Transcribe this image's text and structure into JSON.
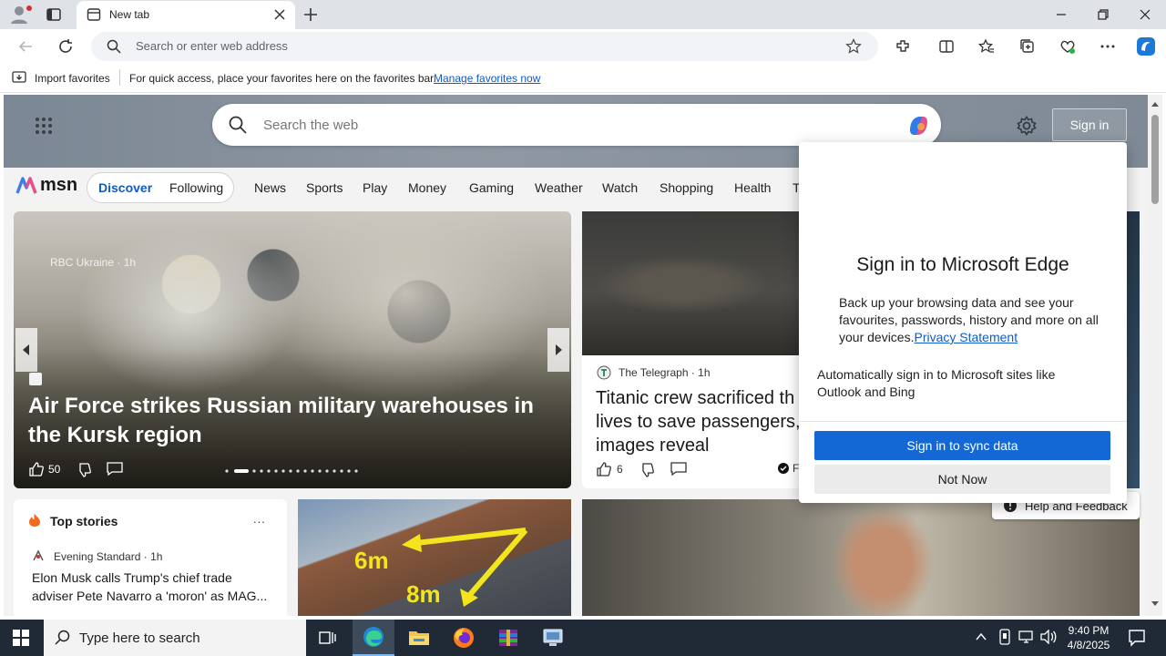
{
  "browser": {
    "tab_title": "New tab",
    "address_placeholder": "Search or enter web address"
  },
  "favorites_bar": {
    "import_label": "Import favorites",
    "hint": "For quick access, place your favorites here on the favorites bar.",
    "manage_link": "Manage favorites now"
  },
  "page": {
    "search_placeholder": "Search the web",
    "sign_in_label": "Sign in",
    "logo_text": "msn",
    "tabs": [
      "Discover",
      "Following"
    ],
    "nav": [
      "News",
      "Sports",
      "Play",
      "Money",
      "Gaming",
      "Weather",
      "Watch",
      "Shopping",
      "Health",
      "T"
    ]
  },
  "hero": {
    "source": "RBC Ukraine",
    "time": "1h",
    "title": "Air Force strikes Russian military warehouses in the Kursk region",
    "likes": "50"
  },
  "telegraph": {
    "source": "The Telegraph",
    "time": "1h",
    "title": "Titanic crew sacrificed their lives to save passengers, images reveal",
    "title_visible": "Titanic crew sacrificed th lives to save passengers, images reveal",
    "likes": "6",
    "extra": "F"
  },
  "top_stories": {
    "heading": "Top stories",
    "more": "...",
    "source": "Evening Standard",
    "time": "1h",
    "headline": "Elon Musk calls Trump's chief trade adviser Pete Navarro a 'moron' as MAG..."
  },
  "solar": {
    "label_6m": "6m",
    "label_8m": "8m"
  },
  "help_button": "Help and Feedback",
  "popup": {
    "title": "Sign in to Microsoft Edge",
    "body": "Back up your browsing data and see your favourites, passwords, history and more on all your devices.",
    "privacy_link": "Privacy Statement",
    "auto_signin": "Automatically sign in to Microsoft sites like Outlook and Bing",
    "primary_button": "Sign in to sync data",
    "secondary_button": "Not Now"
  },
  "taskbar": {
    "search_placeholder": "Type here to search",
    "time": "9:40 PM",
    "date": "4/8/2025"
  },
  "colors": {
    "accent": "#1368d6",
    "link": "#0f5bc7",
    "taskbar": "#1f2a36"
  }
}
